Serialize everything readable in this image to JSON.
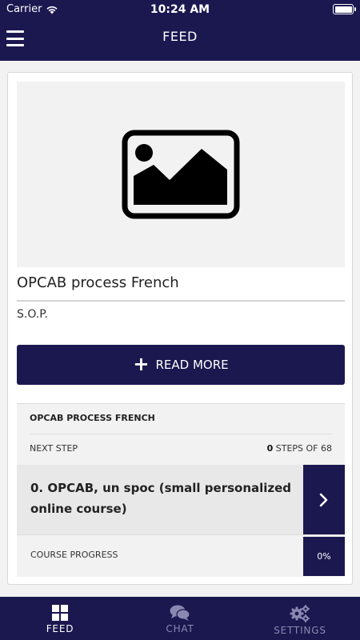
{
  "status_bar": {
    "carrier": "Carrier",
    "time": "10:24 AM"
  },
  "nav": {
    "title": "FEED",
    "menu_icon": "hamburger-menu-icon"
  },
  "post": {
    "image_icon": "image-placeholder-icon",
    "title": "OPCAB process French",
    "subtitle": "S.O.P.",
    "read_more_label": "READ MORE"
  },
  "course": {
    "name": "OPCAB PROCESS FRENCH",
    "next_step_label": "NEXT STEP",
    "steps_current": "0",
    "steps_suffix": "STEPS OF 68",
    "step_title": "0. OPCAB, un spoc (small personalized online course)",
    "progress_label": "COURSE PROGRESS",
    "progress_value": "0%",
    "progress_fraction": 0
  },
  "tabs": [
    {
      "label": "FEED",
      "icon": "grid-icon",
      "active": true
    },
    {
      "label": "CHAT",
      "icon": "chat-bubbles-icon",
      "active": false
    },
    {
      "label": "SETTINGS",
      "icon": "gears-icon",
      "active": false
    }
  ],
  "colors": {
    "primary": "#1b1850",
    "background": "#f2f2f2",
    "tab_inactive": "#8a88b0"
  }
}
